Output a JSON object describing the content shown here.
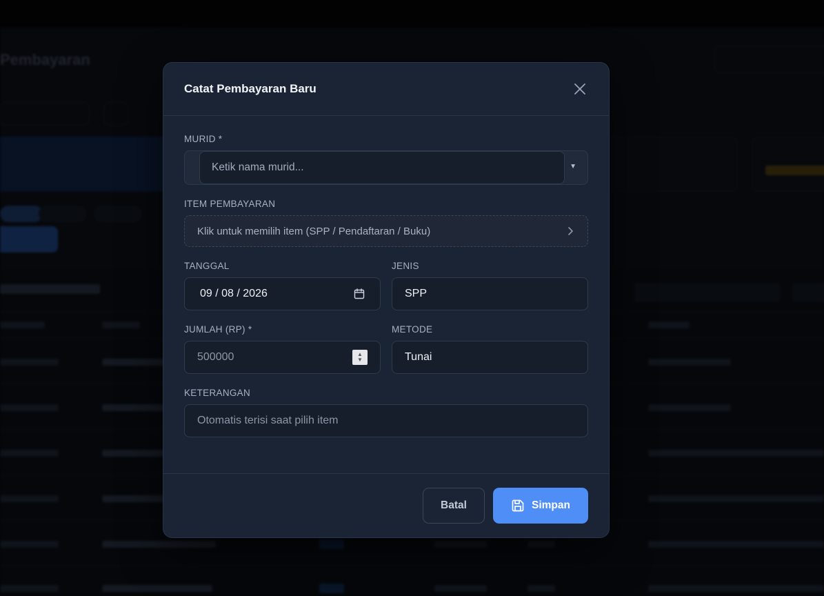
{
  "background": {
    "page_title": "Pembayaran"
  },
  "modal": {
    "title": "Catat Pembayaran Baru",
    "student": {
      "label": "MURID *",
      "placeholder": "Ketik nama murid..."
    },
    "payment_item": {
      "label": "ITEM PEMBAYARAN",
      "placeholder": "Klik untuk memilih item (SPP / Pendaftaran / Buku)"
    },
    "date": {
      "label": "TANGGAL",
      "value": "09 / 08 / 2026"
    },
    "type": {
      "label": "JENIS",
      "value": "SPP"
    },
    "amount": {
      "label": "JUMLAH (RP) *",
      "placeholder": "500000"
    },
    "method": {
      "label": "METODE",
      "value": "Tunai"
    },
    "note": {
      "label": "KETERANGAN",
      "placeholder": "Otomatis terisi saat pilih item"
    },
    "buttons": {
      "cancel": "Batal",
      "save": "Simpan"
    }
  },
  "colors": {
    "accent": "#4f8ef7",
    "modal_bg": "#1b2435",
    "input_bg": "#161e2b"
  }
}
